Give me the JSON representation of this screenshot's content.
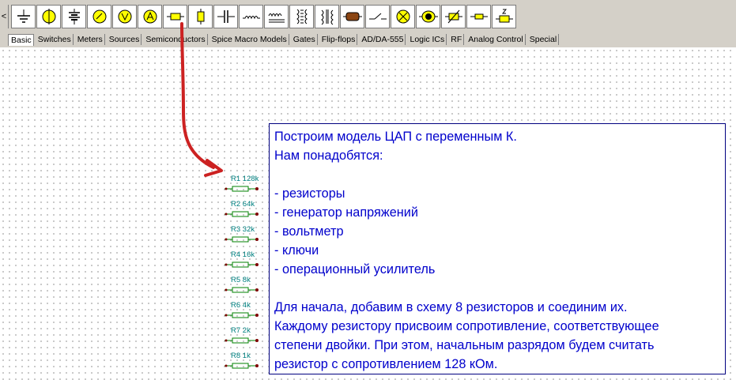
{
  "toolbar": {
    "scroll_left": "<",
    "tools": [
      {
        "name": "ground-tool-icon"
      },
      {
        "name": "lamp-tool-icon"
      },
      {
        "name": "battery-tool-icon"
      },
      {
        "name": "ammeter-meter-tool-icon"
      },
      {
        "name": "voltmeter-tool-icon"
      },
      {
        "name": "ammeter-tool-icon"
      },
      {
        "name": "resistor-tool-icon"
      },
      {
        "name": "resistor-vertical-tool-icon"
      },
      {
        "name": "capacitor-tool-icon"
      },
      {
        "name": "inductor-tool-icon"
      },
      {
        "name": "capacitor-polarized-tool-icon"
      },
      {
        "name": "transformer-tool-icon"
      },
      {
        "name": "transformer-core-tool-icon"
      },
      {
        "name": "fuse-tool-icon"
      },
      {
        "name": "switch-tool-icon"
      },
      {
        "name": "lamp-cross-tool-icon"
      },
      {
        "name": "motor-tool-icon"
      },
      {
        "name": "variable-resistor-tool-icon"
      },
      {
        "name": "resistor-small-tool-icon"
      },
      {
        "name": "zener-resistor-tool-icon"
      }
    ]
  },
  "tabs": [
    "Basic",
    "Switches",
    "Meters",
    "Sources",
    "Semiconductors",
    "Spice Macro Models",
    "Gates",
    "Flip-flops",
    "AD/DA-555",
    "Logic ICs",
    "RF",
    "Analog Control",
    "Special"
  ],
  "resistors": [
    {
      "label": "R1 128k"
    },
    {
      "label": "R2 64k"
    },
    {
      "label": "R3 32k"
    },
    {
      "label": "R4 16k"
    },
    {
      "label": "R5 8k"
    },
    {
      "label": "R6 4k"
    },
    {
      "label": "R7 2k"
    },
    {
      "label": "R8 1k"
    }
  ],
  "note": {
    "lines": [
      "Построим модель ЦАП с переменным К.",
      "Нам понадобятся:",
      "",
      "- резисторы",
      "- генератор напряжений",
      "- вольтметр",
      "- ключи",
      "- операционный усилитель",
      "",
      "Для начала, добавим в схему 8 резисторов и соединим их.",
      "Каждому резистору присвоим сопротивление, соответствующее",
      "степени двойки. При этом, начальным разрядом будем считать",
      "резистор с сопротивлением 128 кОм."
    ]
  },
  "colors": {
    "note_text": "#0000cc",
    "note_border": "#000080",
    "arrow": "#cc2222",
    "resistor_label": "#008080",
    "lamp_yellow": "#ffff00"
  }
}
